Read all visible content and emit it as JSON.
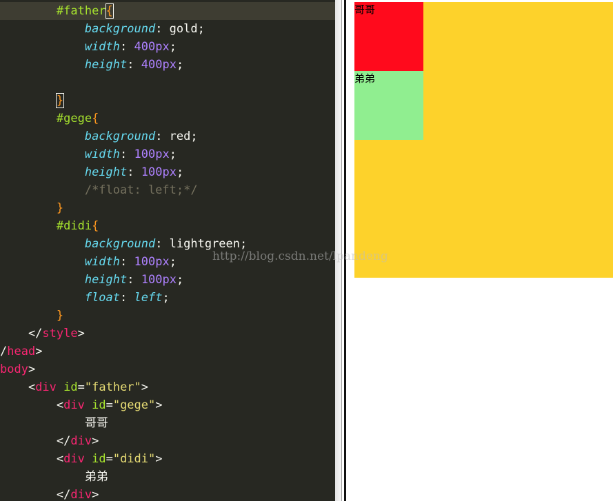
{
  "editor": {
    "lines": [
      [
        {
          "t": "        "
        },
        {
          "t": "#father",
          "c": "t-sel"
        },
        {
          "t": "{",
          "c": "t-brace-match"
        },
        {
          "caret": true
        }
      ],
      [
        {
          "t": "            "
        },
        {
          "t": "background",
          "c": "t-prop"
        },
        {
          "t": ": gold;"
        }
      ],
      [
        {
          "t": "            "
        },
        {
          "t": "width",
          "c": "t-prop"
        },
        {
          "t": ": "
        },
        {
          "t": "400",
          "c": "t-num"
        },
        {
          "t": "px",
          "c": "t-unit"
        },
        {
          "t": ";"
        }
      ],
      [
        {
          "t": "            "
        },
        {
          "t": "height",
          "c": "t-prop"
        },
        {
          "t": ": "
        },
        {
          "t": "400",
          "c": "t-num"
        },
        {
          "t": "px",
          "c": "t-unit"
        },
        {
          "t": ";"
        }
      ],
      [],
      [
        {
          "t": "        "
        },
        {
          "t": "}",
          "c": "t-brace-match"
        }
      ],
      [
        {
          "t": "        "
        },
        {
          "t": "#gege",
          "c": "t-sel"
        },
        {
          "t": "{",
          "c": "t-brace"
        }
      ],
      [
        {
          "t": "            "
        },
        {
          "t": "background",
          "c": "t-prop"
        },
        {
          "t": ": red;"
        }
      ],
      [
        {
          "t": "            "
        },
        {
          "t": "width",
          "c": "t-prop"
        },
        {
          "t": ": "
        },
        {
          "t": "100",
          "c": "t-num"
        },
        {
          "t": "px",
          "c": "t-unit"
        },
        {
          "t": ";"
        }
      ],
      [
        {
          "t": "            "
        },
        {
          "t": "height",
          "c": "t-prop"
        },
        {
          "t": ": "
        },
        {
          "t": "100",
          "c": "t-num"
        },
        {
          "t": "px",
          "c": "t-unit"
        },
        {
          "t": ";"
        }
      ],
      [
        {
          "t": "            "
        },
        {
          "t": "/*float: left;*/",
          "c": "t-cmt"
        }
      ],
      [
        {
          "t": "        "
        },
        {
          "t": "}",
          "c": "t-brace"
        }
      ],
      [
        {
          "t": "        "
        },
        {
          "t": "#didi",
          "c": "t-sel"
        },
        {
          "t": "{",
          "c": "t-brace"
        }
      ],
      [
        {
          "t": "            "
        },
        {
          "t": "background",
          "c": "t-prop"
        },
        {
          "t": ": lightgreen;"
        }
      ],
      [
        {
          "t": "            "
        },
        {
          "t": "width",
          "c": "t-prop"
        },
        {
          "t": ": "
        },
        {
          "t": "100",
          "c": "t-num"
        },
        {
          "t": "px",
          "c": "t-unit"
        },
        {
          "t": ";"
        }
      ],
      [
        {
          "t": "            "
        },
        {
          "t": "height",
          "c": "t-prop"
        },
        {
          "t": ": "
        },
        {
          "t": "100",
          "c": "t-num"
        },
        {
          "t": "px",
          "c": "t-unit"
        },
        {
          "t": ";"
        }
      ],
      [
        {
          "t": "            "
        },
        {
          "t": "float",
          "c": "t-prop"
        },
        {
          "t": ": "
        },
        {
          "t": "left",
          "c": "t-kw"
        },
        {
          "t": ";"
        }
      ],
      [
        {
          "t": "        "
        },
        {
          "t": "}",
          "c": "t-brace"
        }
      ],
      [
        {
          "t": "    </"
        },
        {
          "t": "style",
          "c": "t-tag"
        },
        {
          "t": ">"
        }
      ],
      [
        {
          "t": "/"
        },
        {
          "t": "head",
          "c": "t-tag"
        },
        {
          "t": ">"
        }
      ],
      [
        {
          "t": "body",
          "c": "t-tag"
        },
        {
          "t": ">"
        }
      ],
      [
        {
          "t": "    <"
        },
        {
          "t": "div",
          "c": "t-tag"
        },
        {
          "t": " "
        },
        {
          "t": "id",
          "c": "t-attr"
        },
        {
          "t": "="
        },
        {
          "t": "\"father\"",
          "c": "t-str"
        },
        {
          "t": ">"
        }
      ],
      [
        {
          "t": "        <"
        },
        {
          "t": "div",
          "c": "t-tag"
        },
        {
          "t": " "
        },
        {
          "t": "id",
          "c": "t-attr"
        },
        {
          "t": "="
        },
        {
          "t": "\"gege\"",
          "c": "t-str"
        },
        {
          "t": ">"
        }
      ],
      [
        {
          "t": "            哥哥"
        }
      ],
      [
        {
          "t": "        </"
        },
        {
          "t": "div",
          "c": "t-tag"
        },
        {
          "t": ">"
        }
      ],
      [
        {
          "t": "        <"
        },
        {
          "t": "div",
          "c": "t-tag"
        },
        {
          "t": " "
        },
        {
          "t": "id",
          "c": "t-attr"
        },
        {
          "t": "="
        },
        {
          "t": "\"didi\"",
          "c": "t-str"
        },
        {
          "t": ">"
        }
      ],
      [
        {
          "t": "            弟弟"
        }
      ],
      [
        {
          "t": "        </"
        },
        {
          "t": "div",
          "c": "t-tag"
        },
        {
          "t": ">"
        }
      ]
    ],
    "current_line": 0,
    "colors": {
      "background": "#272822",
      "selector": "#a6e22e",
      "property": "#66d9ef",
      "number": "#ae81ff",
      "tag": "#f92672",
      "string": "#e6db74",
      "comment": "#75715e",
      "brace": "#fd971f"
    }
  },
  "preview": {
    "father": {
      "color": "#fdd22b"
    },
    "gege": {
      "text": "哥哥",
      "color": "#ff0a1c"
    },
    "didi": {
      "text": "弟弟",
      "color": "#90ee90"
    }
  },
  "watermark": "http://blog.csdn.net/lpandeng"
}
